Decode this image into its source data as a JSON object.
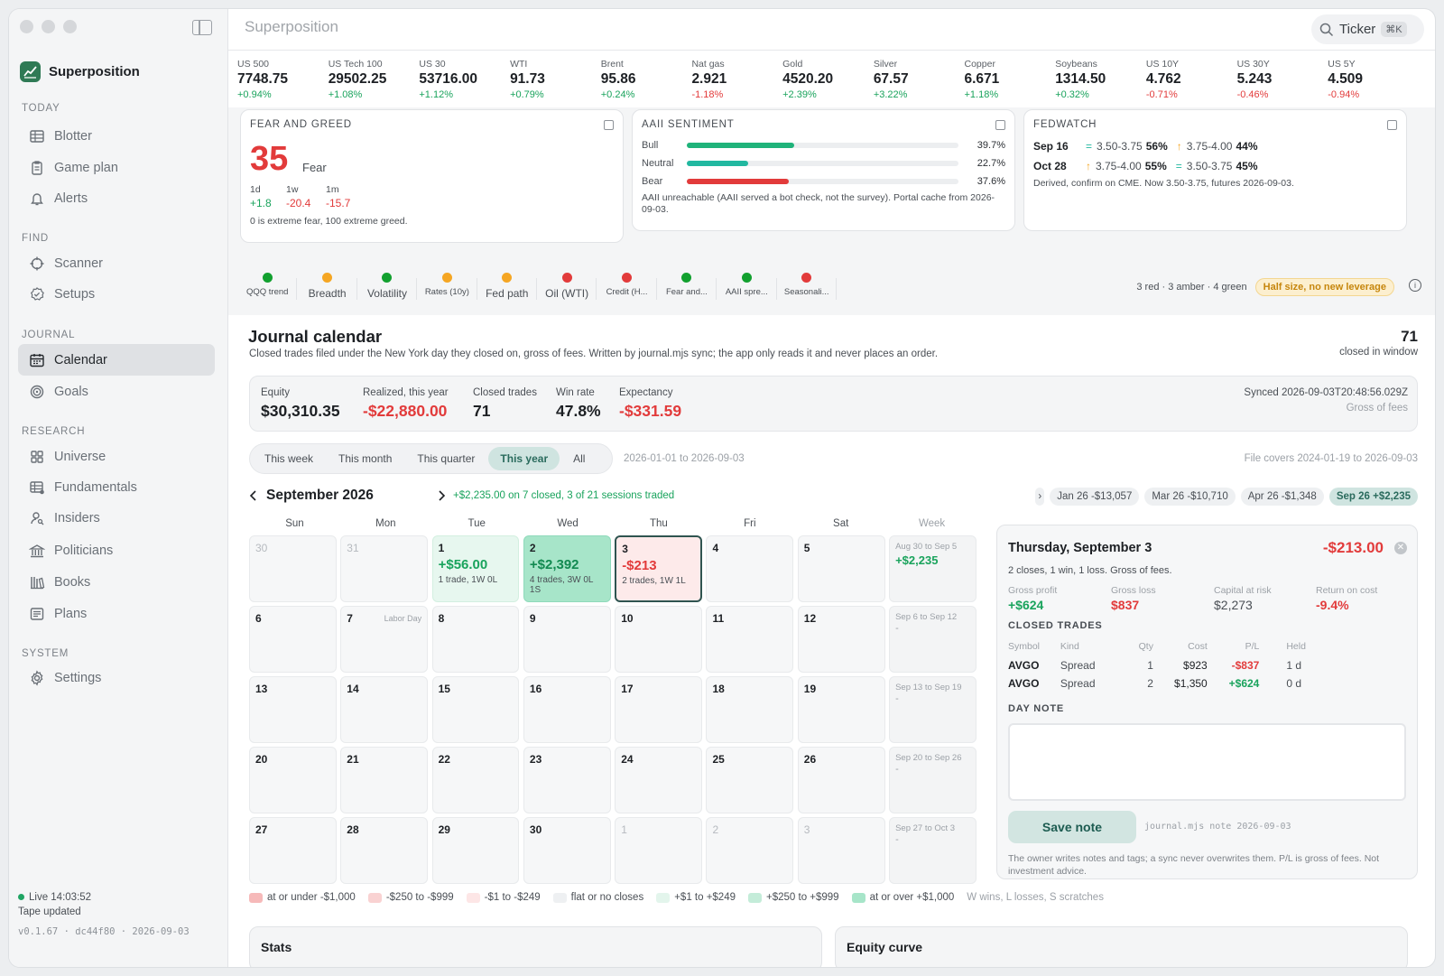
{
  "app": {
    "title": "Superposition",
    "brand": "Superposition",
    "search_label": "Ticker",
    "search_kbd": "⌘K"
  },
  "sidebar": {
    "sections": [
      {
        "label": "TODAY",
        "items": [
          {
            "label": "Blotter",
            "icon": "table-icon"
          },
          {
            "label": "Game plan",
            "icon": "clipboard-icon"
          },
          {
            "label": "Alerts",
            "icon": "bell-icon"
          }
        ]
      },
      {
        "label": "FIND",
        "items": [
          {
            "label": "Scanner",
            "icon": "crosshair-icon"
          },
          {
            "label": "Setups",
            "icon": "badge-check-icon"
          }
        ]
      },
      {
        "label": "JOURNAL",
        "items": [
          {
            "label": "Calendar",
            "icon": "calendar-icon",
            "active": true
          },
          {
            "label": "Goals",
            "icon": "target-icon"
          }
        ]
      },
      {
        "label": "RESEARCH",
        "items": [
          {
            "label": "Universe",
            "icon": "grid-icon"
          },
          {
            "label": "Fundamentals",
            "icon": "table-dot-icon"
          },
          {
            "label": "Insiders",
            "icon": "user-search-icon"
          },
          {
            "label": "Politicians",
            "icon": "landmark-icon"
          },
          {
            "label": "Books",
            "icon": "library-icon"
          },
          {
            "label": "Plans",
            "icon": "notes-icon"
          }
        ]
      },
      {
        "label": "SYSTEM",
        "items": [
          {
            "label": "Settings",
            "icon": "gear-icon"
          }
        ]
      }
    ],
    "status_live": "Live 14:03:52",
    "status_tape": "Tape updated",
    "version": "v0.1.67 · dc44f80 · 2026-09-03"
  },
  "ticker": [
    {
      "name": "US 500",
      "value": "7748.75",
      "change": "+0.94%",
      "dir": "pos"
    },
    {
      "name": "US Tech 100",
      "value": "29502.25",
      "change": "+1.08%",
      "dir": "pos"
    },
    {
      "name": "US 30",
      "value": "53716.00",
      "change": "+1.12%",
      "dir": "pos"
    },
    {
      "name": "WTI",
      "value": "91.73",
      "change": "+0.79%",
      "dir": "pos"
    },
    {
      "name": "Brent",
      "value": "95.86",
      "change": "+0.24%",
      "dir": "pos"
    },
    {
      "name": "Nat gas",
      "value": "2.921",
      "change": "-1.18%",
      "dir": "neg"
    },
    {
      "name": "Gold",
      "value": "4520.20",
      "change": "+2.39%",
      "dir": "pos"
    },
    {
      "name": "Silver",
      "value": "67.57",
      "change": "+3.22%",
      "dir": "pos"
    },
    {
      "name": "Copper",
      "value": "6.671",
      "change": "+1.18%",
      "dir": "pos"
    },
    {
      "name": "Soybeans",
      "value": "1314.50",
      "change": "+0.32%",
      "dir": "pos"
    },
    {
      "name": "US 10Y",
      "value": "4.762",
      "change": "-0.71%",
      "dir": "neg"
    },
    {
      "name": "US 30Y",
      "value": "5.243",
      "change": "-0.46%",
      "dir": "neg"
    },
    {
      "name": "US 5Y",
      "value": "4.509",
      "change": "-0.94%",
      "dir": "neg"
    }
  ],
  "fear_greed": {
    "title": "FEAR AND GREED",
    "value": "35",
    "label": "Fear",
    "changes": [
      {
        "period": "1d",
        "value": "+1.8",
        "dir": "pos"
      },
      {
        "period": "1w",
        "value": "-20.4",
        "dir": "neg"
      },
      {
        "period": "1m",
        "value": "-15.7",
        "dir": "neg"
      }
    ],
    "note": "0 is extreme fear, 100 extreme greed."
  },
  "aaii": {
    "title": "AAII SENTIMENT",
    "rows": [
      {
        "label": "Bull",
        "pct": "39.7%",
        "value": 39.7,
        "color": "#1fb37a"
      },
      {
        "label": "Neutral",
        "pct": "22.7%",
        "value": 22.7,
        "color": "#22b8a0"
      },
      {
        "label": "Bear",
        "pct": "37.6%",
        "value": 37.6,
        "color": "#e23b3b"
      }
    ],
    "note": "AAII unreachable (AAII served a bot check, not the survey). Portal cache from 2026-09-03."
  },
  "fedwatch": {
    "title": "FEDWATCH",
    "rows": [
      {
        "date": "Sep 16",
        "a_sym": "=",
        "a_range": "3.50-3.75",
        "a_pct": "56%",
        "b_sym": "↑",
        "b_range": "3.75-4.00",
        "b_pct": "44%"
      },
      {
        "date": "Oct 28",
        "a_sym": "↑",
        "a_range": "3.75-4.00",
        "a_pct": "55%",
        "b_sym": "=",
        "b_range": "3.50-3.75",
        "b_pct": "45%"
      }
    ],
    "note": "Derived, confirm on CME. Now 3.50-3.75, futures 2026-09-03."
  },
  "signals": [
    {
      "label": "QQQ trend",
      "color": "#12a02f",
      "big": false
    },
    {
      "label": "Breadth",
      "color": "#f5a623",
      "big": true
    },
    {
      "label": "Volatility",
      "color": "#12a02f",
      "big": true
    },
    {
      "label": "Rates (10y)",
      "color": "#f5a623",
      "big": false
    },
    {
      "label": "Fed path",
      "color": "#f5a623",
      "big": true
    },
    {
      "label": "Oil (WTI)",
      "color": "#e23b3b",
      "big": true
    },
    {
      "label": "Credit (H...",
      "color": "#e23b3b",
      "big": false
    },
    {
      "label": "Fear and...",
      "color": "#12a02f",
      "big": false
    },
    {
      "label": "AAII spre...",
      "color": "#12a02f",
      "big": false
    },
    {
      "label": "Seasonali...",
      "color": "#e23b3b",
      "big": false
    }
  ],
  "signal_summary": "3 red · 3 amber · 4 green",
  "signal_badge": "Half size, no new leverage",
  "journal": {
    "title": "Journal calendar",
    "subtitle": "Closed trades filed under the New York day they closed on, gross of fees. Written by journal.mjs sync; the app only reads it and never places an order.",
    "count": "71",
    "count_label": "closed in window",
    "stats": [
      {
        "label": "Equity",
        "value": "$30,310.35",
        "dir": ""
      },
      {
        "label": "Realized, this year",
        "value": "-$22,880.00",
        "dir": "neg"
      },
      {
        "label": "Closed trades",
        "value": "71",
        "dir": ""
      },
      {
        "label": "Win rate",
        "value": "47.8%",
        "dir": ""
      },
      {
        "label": "Expectancy",
        "value": "-$331.59",
        "dir": "neg"
      }
    ],
    "synced": "Synced 2026-09-03T20:48:56.029Z",
    "gross": "Gross of fees",
    "ranges": [
      "This week",
      "This month",
      "This quarter",
      "This year",
      "All"
    ],
    "active_range": "This year",
    "range_text": "2026-01-01 to 2026-09-03",
    "file_covers": "File covers 2024-01-19 to 2026-09-03",
    "month_title": "September 2026",
    "month_summary": "+$2,235.00 on 7 closed, 3 of 21 sessions traded",
    "month_pills": [
      {
        "label": "Jan 26 -$13,057",
        "on": false
      },
      {
        "label": "Mar 26 -$10,710",
        "on": false
      },
      {
        "label": "Apr 26 -$1,348",
        "on": false
      },
      {
        "label": "Sep 26 +$2,235",
        "on": true
      }
    ],
    "weekdays": [
      "Sun",
      "Mon",
      "Tue",
      "Wed",
      "Thu",
      "Fri",
      "Sat",
      "Week"
    ],
    "weeks": [
      {
        "days": [
          {
            "d": "30",
            "out": true
          },
          {
            "d": "31",
            "out": true
          },
          {
            "d": "1",
            "amt": "+$56.00",
            "trades": "1 trade, 1W 0L",
            "cls": "g1"
          },
          {
            "d": "2",
            "amt": "+$2,392",
            "trades": "4 trades, 3W 0L 1S",
            "cls": "g2"
          },
          {
            "d": "3",
            "amt": "-$213",
            "trades": "2 trades, 1W 1L",
            "cls": "r1"
          },
          {
            "d": "4"
          },
          {
            "d": "5"
          }
        ],
        "range": "Aug 30 to Sep 5",
        "sum": "+$2,235"
      },
      {
        "days": [
          {
            "d": "6"
          },
          {
            "d": "7",
            "holiday": "Labor Day"
          },
          {
            "d": "8"
          },
          {
            "d": "9"
          },
          {
            "d": "10"
          },
          {
            "d": "11"
          },
          {
            "d": "12"
          }
        ],
        "range": "Sep 6 to Sep 12",
        "sum": "-"
      },
      {
        "days": [
          {
            "d": "13"
          },
          {
            "d": "14"
          },
          {
            "d": "15"
          },
          {
            "d": "16"
          },
          {
            "d": "17"
          },
          {
            "d": "18"
          },
          {
            "d": "19"
          }
        ],
        "range": "Sep 13 to Sep 19",
        "sum": "-"
      },
      {
        "days": [
          {
            "d": "20"
          },
          {
            "d": "21"
          },
          {
            "d": "22"
          },
          {
            "d": "23"
          },
          {
            "d": "24"
          },
          {
            "d": "25"
          },
          {
            "d": "26"
          }
        ],
        "range": "Sep 20 to Sep 26",
        "sum": "-"
      },
      {
        "days": [
          {
            "d": "27"
          },
          {
            "d": "28"
          },
          {
            "d": "29"
          },
          {
            "d": "30"
          },
          {
            "d": "1",
            "out": true
          },
          {
            "d": "2",
            "out": true
          },
          {
            "d": "3",
            "out": true
          }
        ],
        "range": "Sep 27 to Oct 3",
        "sum": "-"
      }
    ],
    "legend": [
      {
        "label": "at or under -$1,000",
        "color": "#f6b9b9"
      },
      {
        "label": "-$250 to -$999",
        "color": "#f9d2d2"
      },
      {
        "label": "-$1 to -$249",
        "color": "#fde6e6"
      },
      {
        "label": "flat or no closes",
        "color": "#eef0f2"
      },
      {
        "label": "+$1 to +$249",
        "color": "#e3f5ec"
      },
      {
        "label": "+$250 to +$999",
        "color": "#c4ecd9"
      },
      {
        "label": "at or over +$1,000",
        "color": "#a7e5c9"
      }
    ],
    "legend_hint": "W wins, L losses, S scratches",
    "bottom_left": "Stats",
    "bottom_right": "Equity curve"
  },
  "detail": {
    "day": "Thursday, September 3",
    "amount": "-$213.00",
    "summary": "2 closes, 1 win, 1 loss. Gross of fees.",
    "metrics": [
      {
        "label": "Gross profit",
        "value": "+$624",
        "dir": "pos"
      },
      {
        "label": "Gross loss",
        "value": "$837",
        "dir": "neg"
      },
      {
        "label": "Capital at risk",
        "value": "$2,273",
        "dir": "mute"
      },
      {
        "label": "Return on cost",
        "value": "-9.4%",
        "dir": "neg"
      }
    ],
    "closed_heading": "CLOSED TRADES",
    "columns": [
      "Symbol",
      "Kind",
      "Qty",
      "Cost",
      "P/L",
      "Held"
    ],
    "trades": [
      {
        "symbol": "AVGO",
        "kind": "Spread",
        "qty": "1",
        "cost": "$923",
        "pl": "-$837",
        "dir": "neg",
        "held": "1 d"
      },
      {
        "symbol": "AVGO",
        "kind": "Spread",
        "qty": "2",
        "cost": "$1,350",
        "pl": "+$624",
        "dir": "pos",
        "held": "0 d"
      }
    ],
    "note_heading": "DAY NOTE",
    "save_label": "Save note",
    "cmd": "journal.mjs note 2026-09-03",
    "footer": "The owner writes notes and tags; a sync never overwrites them. P/L is gross of fees. Not investment advice."
  }
}
